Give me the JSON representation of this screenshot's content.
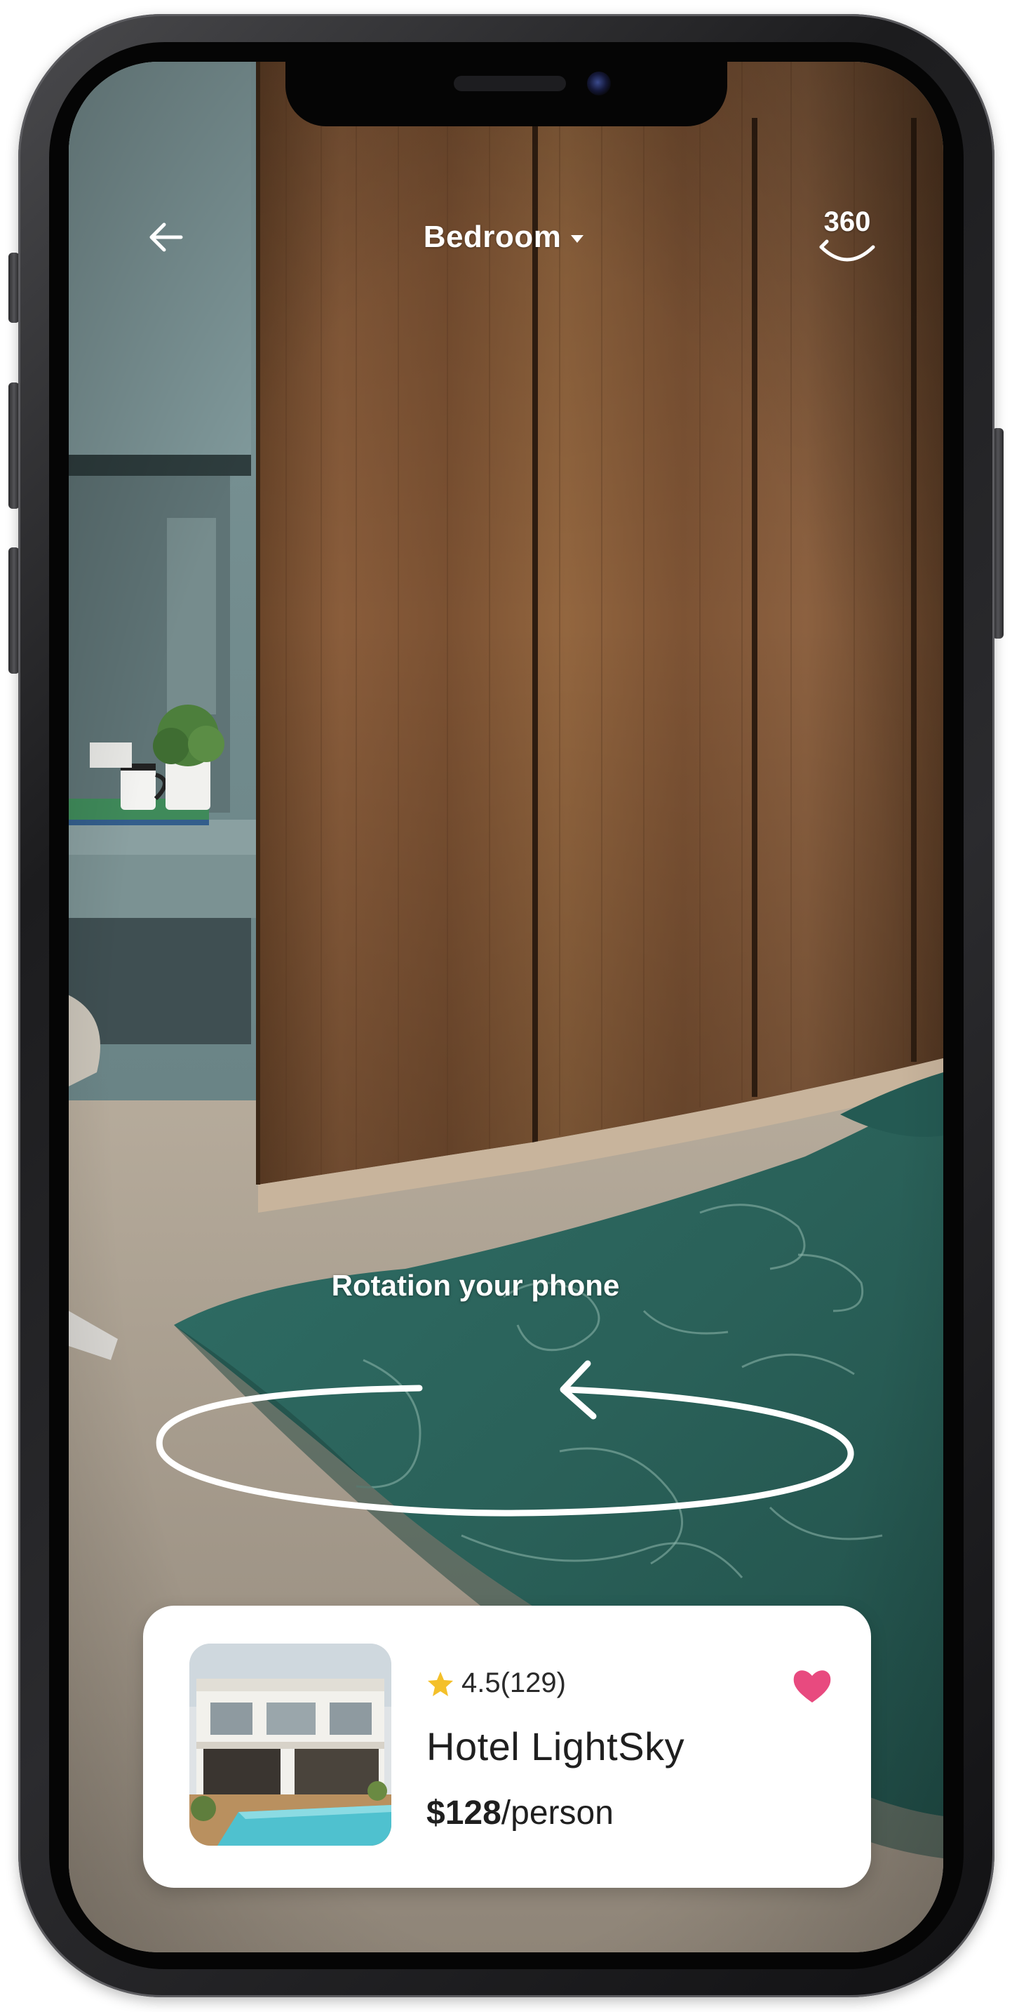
{
  "header": {
    "back_icon": "arrow-left-icon",
    "room_label": "Bedroom",
    "dropdown_icon": "caret-down-icon",
    "view_360_label": "360",
    "view_360_icon": "360-view-icon"
  },
  "hint": {
    "text": "Rotation your phone",
    "icon": "rotate-arrow-icon"
  },
  "hotel_card": {
    "rating_icon": "star-icon",
    "rating": "4.5(129)",
    "name": "Hotel LightSky",
    "price": "$128",
    "price_unit": "/person",
    "favorite_icon": "heart-icon",
    "favorite_color": "#e84a7f"
  },
  "colors": {
    "wardrobe_wood": "#7a5233",
    "wall_teal": "#6f8a8c",
    "blanket_green": "#2f6b63",
    "floor": "#a59c8e"
  }
}
